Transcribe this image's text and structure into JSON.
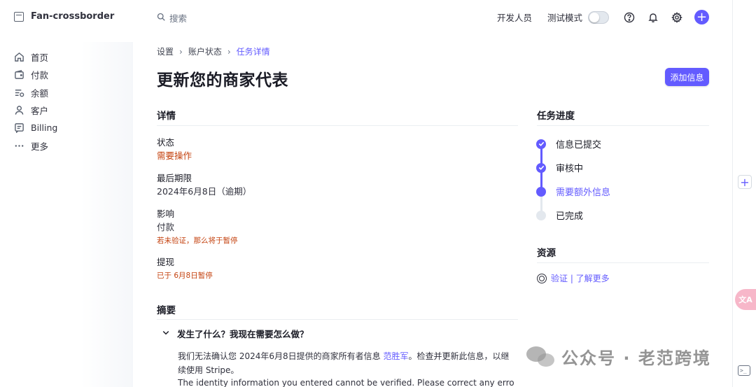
{
  "brand": {
    "name": "Fan-crossborder"
  },
  "nav": {
    "items": [
      {
        "label": "首页",
        "icon": "home-icon"
      },
      {
        "label": "付款",
        "icon": "wallet-icon"
      },
      {
        "label": "余额",
        "icon": "balance-icon"
      },
      {
        "label": "客户",
        "icon": "user-icon"
      },
      {
        "label": "Billing",
        "icon": "billing-icon"
      },
      {
        "label": "更多",
        "icon": "more-icon"
      }
    ]
  },
  "header": {
    "search_placeholder": "搜索",
    "developers": "开发人员",
    "test_mode": "测试模式",
    "test_mode_on": false
  },
  "breadcrumb": [
    "设置",
    "账户状态",
    "任务详情"
  ],
  "page": {
    "title": "更新您的商家代表",
    "add_info_button": "添加信息"
  },
  "details": {
    "title": "详情",
    "status_label": "状态",
    "status_value": "需要操作",
    "deadline_label": "最后期限",
    "deadline_value": "2024年6月8日（逾期）",
    "impact_label": "影响",
    "impact_value": "付款",
    "impact_note": "若未验证，那么将于暂停",
    "payout_label": "提现",
    "payout_note": "已于 6月8日暂停"
  },
  "summary": {
    "title": "摘要",
    "question": "发生了什么？我现在需要怎么做？",
    "body_part1": "我们无法确认您 2024年6月8日提供的商家所有者信息 ",
    "body_link": "范胜军",
    "body_part2": "。检查并更新此信息，以继续使用 Stripe。",
    "body_en": "The identity information you entered cannot be verified. Please correct any errors or"
  },
  "progress": {
    "title": "任务进度",
    "steps": [
      {
        "label": "信息已提交",
        "state": "done"
      },
      {
        "label": "审核中",
        "state": "done"
      },
      {
        "label": "需要额外信息",
        "state": "active"
      },
      {
        "label": "已完成",
        "state": "todo"
      }
    ]
  },
  "resources": {
    "title": "资源",
    "link": "验证 | 了解更多"
  },
  "watermark": {
    "text": "公众号 · 老范跨境"
  },
  "colors": {
    "accent": "#635bff",
    "warning": "#c4420f",
    "text": "#1a1b25"
  }
}
